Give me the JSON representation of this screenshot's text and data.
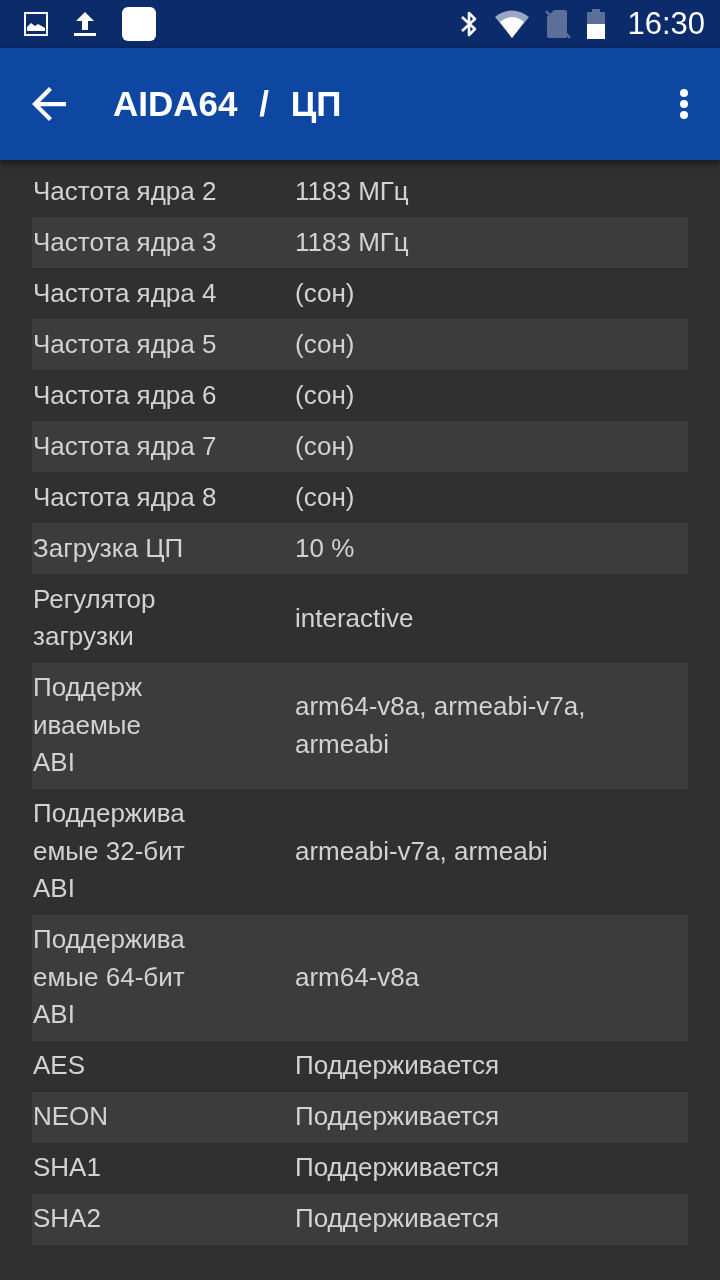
{
  "status_bar": {
    "time": "16:30"
  },
  "app_bar": {
    "title": "AIDA64 / ЦП"
  },
  "rows": [
    {
      "label": "Частота ядра 2",
      "value": "1183 МГц"
    },
    {
      "label": "Частота ядра 3",
      "value": "1183 МГц"
    },
    {
      "label": "Частота ядра 4",
      "value": "(сон)"
    },
    {
      "label": "Частота ядра 5",
      "value": "(сон)"
    },
    {
      "label": "Частота ядра 6",
      "value": "(сон)"
    },
    {
      "label": "Частота ядра 7",
      "value": "(сон)"
    },
    {
      "label": "Частота ядра 8",
      "value": "(сон)"
    },
    {
      "label": "Загрузка ЦП",
      "value": "10 %"
    },
    {
      "label": "Регулятор\nзагрузки",
      "value": "interactive"
    },
    {
      "label": "Поддерж\nиваемые\nABI",
      "value": "arm64-v8a, armeabi-v7a,\narmeabi"
    },
    {
      "label": "Поддержива\nемые 32-бит\nABI",
      "value": "armeabi-v7a, armeabi"
    },
    {
      "label": "Поддержива\nемые 64-бит\nABI",
      "value": "arm64-v8a"
    },
    {
      "label": "AES",
      "value": "Поддерживается"
    },
    {
      "label": "NEON",
      "value": "Поддерживается"
    },
    {
      "label": "SHA1",
      "value": "Поддерживается"
    },
    {
      "label": "SHA2",
      "value": "Поддерживается"
    }
  ]
}
